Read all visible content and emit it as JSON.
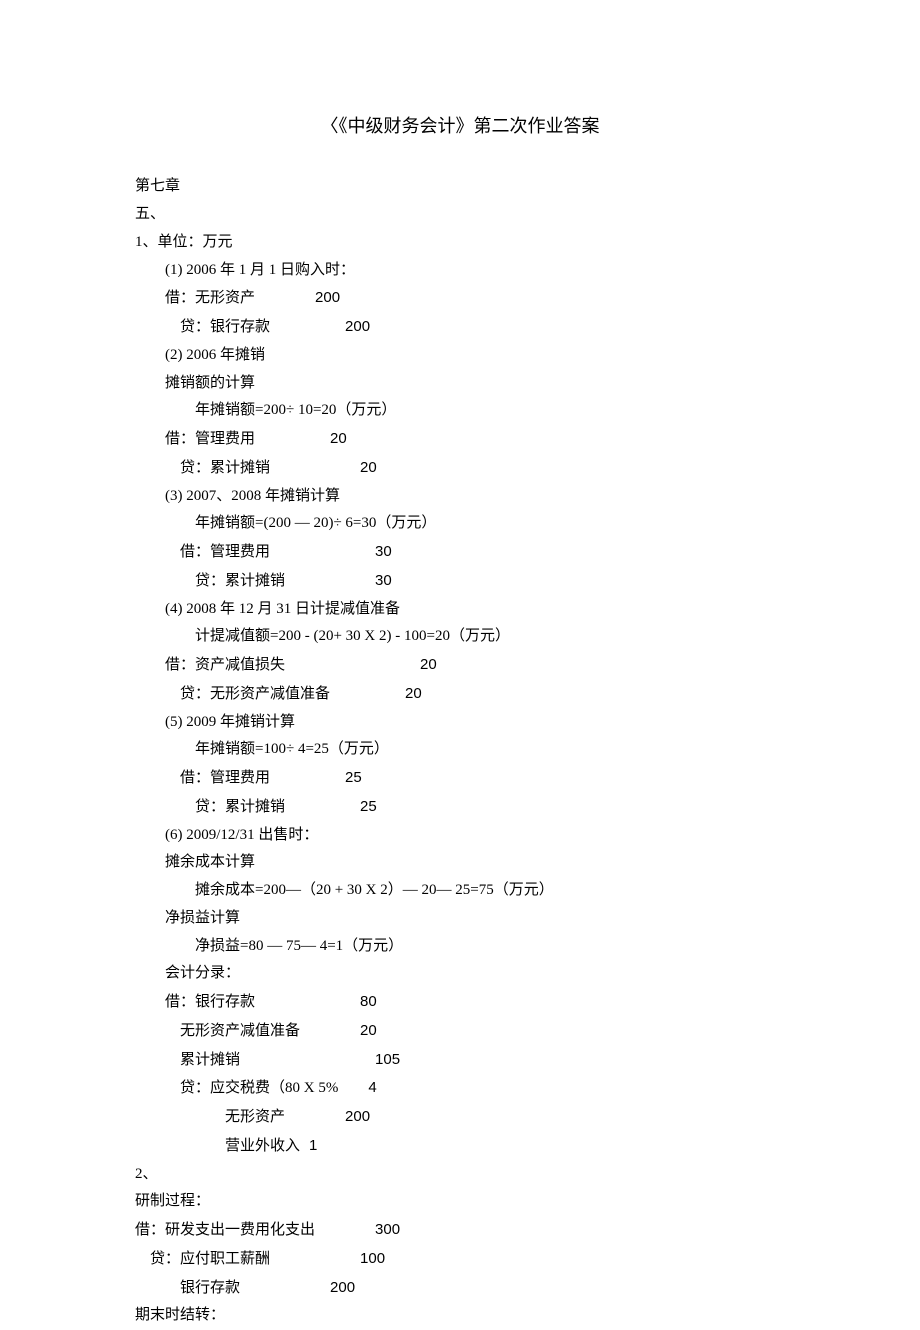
{
  "title": "〈《中级财务会计》第二次作业答案",
  "chapter": "第七章",
  "section": "五、",
  "q1": {
    "header": "1、单位：万元",
    "s1": {
      "h": "(1)   2006 年 1 月 1 日购入时：",
      "l1a": "借：无形资产",
      "l1b": "200",
      "l2a": "贷：银行存款",
      "l2b": "200"
    },
    "s2": {
      "h": "(2)   2006 年摊销",
      "calc_label": "摊销额的计算",
      "calc": "年摊销额=200÷ 10=20（万元）",
      "l1a": "借：管理费用",
      "l1b": "20",
      "l2a": "贷：累计摊销",
      "l2b": "20"
    },
    "s3": {
      "h": "(3)   2007、2008 年摊销计算",
      "calc": "年摊销额=(200 — 20)÷ 6=30（万元）",
      "l1a": "借：管理费用",
      "l1b": "30",
      "l2a": "贷：累计摊销",
      "l2b": "30"
    },
    "s4": {
      "h": "(4)   2008 年 12 月 31 日计提减值准备",
      "calc": "计提减值额=200 - (20+ 30 X 2) - 100=20（万元）",
      "l1a": "借：资产减值损失",
      "l1b": "20",
      "l2a": "贷：无形资产减值准备",
      "l2b": "20"
    },
    "s5": {
      "h": "(5)   2009 年摊销计算",
      "calc": "年摊销额=100÷ 4=25（万元）",
      "l1a": "借：管理费用",
      "l1b": "25",
      "l2a": "贷：累计摊销",
      "l2b": "25"
    },
    "s6": {
      "h": "(6)   2009/12/31 出售时：",
      "c1_label": "摊余成本计算",
      "c1": "摊余成本=200—（20 + 30 X 2）— 20— 25=75（万元）",
      "c2_label": "净损益计算",
      "c2": "净损益=80 — 75— 4=1（万元）",
      "entries_label": "会计分录：",
      "l1a": "借：银行存款",
      "l1b": "80",
      "l2a": "无形资产减值准备",
      "l2b": "20",
      "l3a": "累计摊销",
      "l3b": "105",
      "l4a": "贷：应交税费（80 X 5%",
      "l4b": "4",
      "l5a": "无形资产",
      "l5b": "200",
      "l6a": "营业外收入",
      "l6b": "1"
    }
  },
  "q2": {
    "header": "2、",
    "process": "研制过程：",
    "l1a": "借：研发支出一费用化支出",
    "l1b": "300",
    "l2a": "贷：应付职工薪酬",
    "l2b": "100",
    "l3a": "银行存款",
    "l3b": "200",
    "close": "期末时结转："
  }
}
